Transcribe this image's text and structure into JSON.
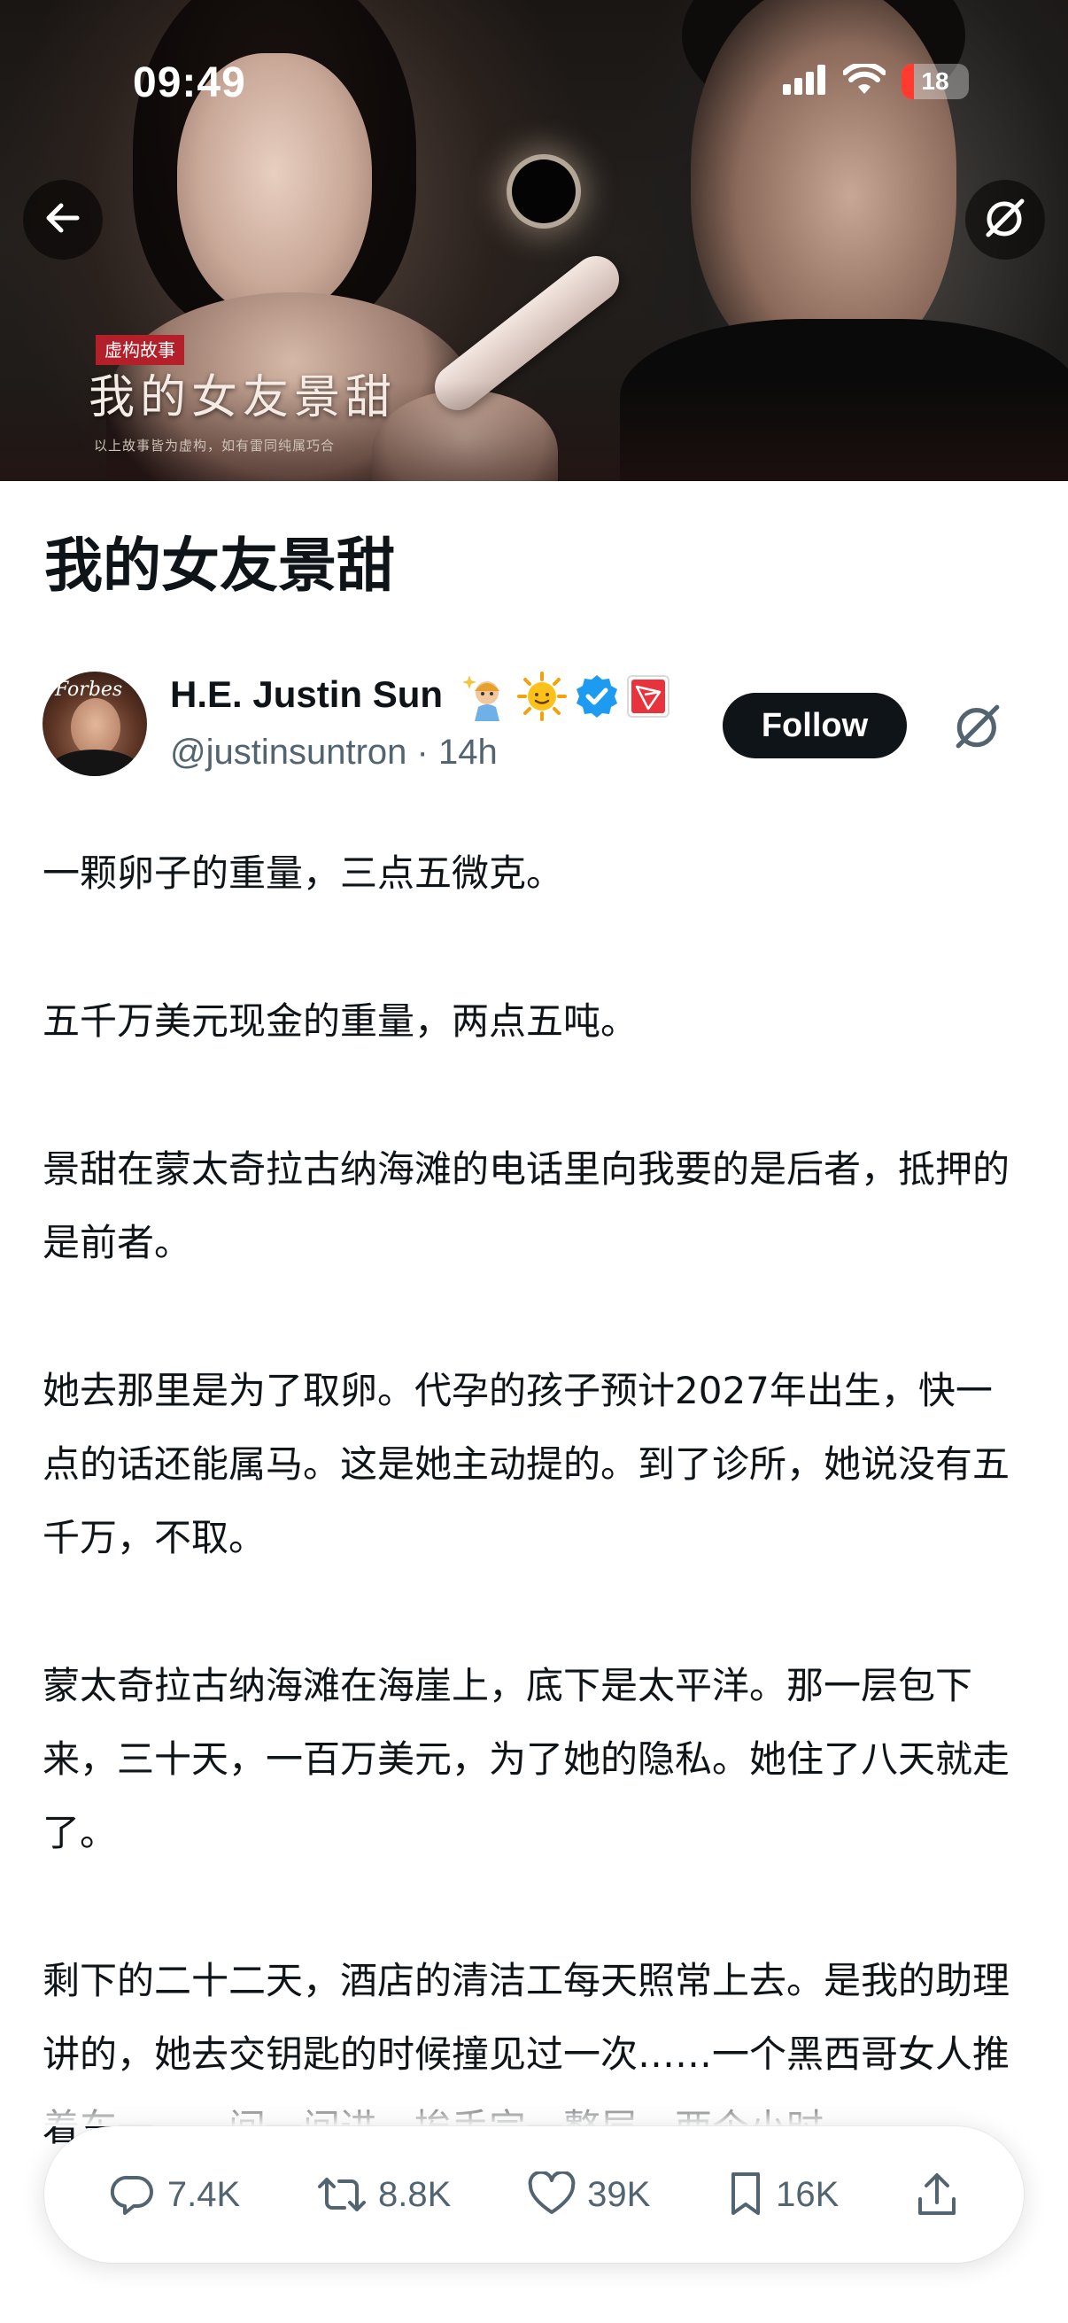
{
  "status_bar": {
    "time": "09:49",
    "battery": "18"
  },
  "hero": {
    "poster_tag": "虚构故事",
    "poster_title": "我的女友景甜",
    "poster_subtitle": "以上故事皆为虚构，如有雷同纯属巧合"
  },
  "article": {
    "title": "我的女友景甜",
    "author": {
      "name": "H.E. Justin Sun",
      "handle": "@justinsuntron",
      "time": "14h",
      "avatar_text": "Forbes",
      "follow_label": "Follow"
    },
    "paragraphs": [
      "一颗卵子的重量，三点五微克。",
      "五千万美元现金的重量，两点五吨。",
      "景甜在蒙太奇拉古纳海滩的电话里向我要的是后者，抵押的是前者。",
      "她去那里是为了取卵。代孕的孩子预计2027年出生，快一点的话还能属马。这是她主动提的。到了诊所，她说没有五千万，不取。",
      "蒙太奇拉古纳海滩在海崖上，底下是太平洋。那一层包下来，三十天，一百万美元，为了她的隐私。她住了八天就走了。",
      "剩下的二十二天，酒店的清洁工每天照常上去。是我的助理讲的，她去交钥匙的时候撞见过一次……一个黑西哥女人推着车一……间一间进，挨手完一整层，两个小时。"
    ]
  },
  "actions": {
    "replies": "7.4K",
    "reposts": "8.8K",
    "likes": "39K",
    "bookmarks": "16K"
  },
  "icons": [
    "back-arrow-icon",
    "grok-icon",
    "signal-icon",
    "wifi-icon",
    "battery-icon",
    "verified-icon",
    "tron-icon",
    "emoji-genie-icon",
    "emoji-sun-icon",
    "reply-icon",
    "repost-icon",
    "like-icon",
    "bookmark-icon",
    "share-icon"
  ],
  "colors": {
    "text": "#0f1419",
    "secondary": "#536471",
    "verified": "#1d9bf0",
    "tron": "#e8333d"
  }
}
